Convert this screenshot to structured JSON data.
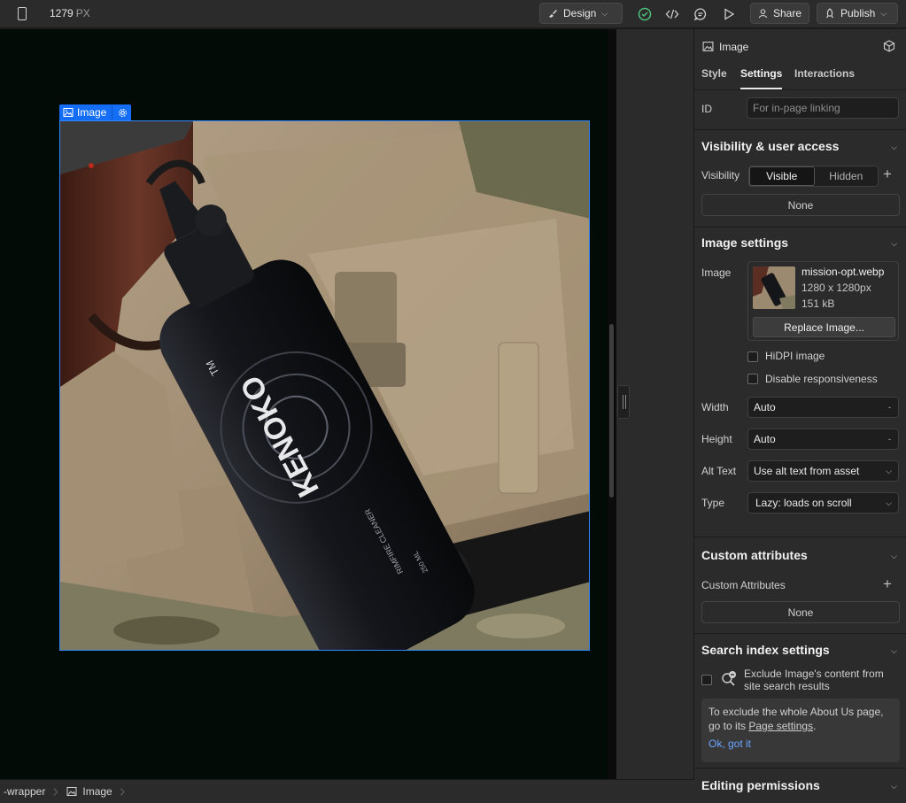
{
  "topbar": {
    "width_value": "1279",
    "width_unit": "PX",
    "design_label": "Design",
    "share_label": "Share",
    "publish_label": "Publish"
  },
  "canvas": {
    "selected_element_label": "Image"
  },
  "breadcrumbs": [
    {
      "label": "-wrapper"
    },
    {
      "label": "Image"
    }
  ],
  "panel": {
    "element_title": "Image",
    "tabs": [
      {
        "label": "Style"
      },
      {
        "label": "Settings"
      },
      {
        "label": "Interactions"
      }
    ],
    "id_label": "ID",
    "id_placeholder": "For in-page linking",
    "visibility_section": {
      "title": "Visibility & user access",
      "visibility_label": "Visibility",
      "visible_option": "Visible",
      "hidden_option": "Hidden",
      "access_value": "None"
    },
    "image_settings": {
      "title": "Image settings",
      "image_label": "Image",
      "file_name": "mission-opt.webp",
      "dimensions": "1280 x 1280px",
      "file_size": "151 kB",
      "replace_label": "Replace Image...",
      "hidpi_label": "HiDPI image",
      "disable_resp_label": "Disable responsiveness",
      "width_label": "Width",
      "width_value": "Auto",
      "width_suffix": "-",
      "height_label": "Height",
      "height_value": "Auto",
      "height_suffix": "-",
      "alt_label": "Alt Text",
      "alt_value": "Use alt text from asset",
      "type_label": "Type",
      "type_value": "Lazy: loads on scroll"
    },
    "custom_attributes": {
      "title": "Custom attributes",
      "sub_label": "Custom Attributes",
      "value": "None"
    },
    "search_index": {
      "title": "Search index settings",
      "exclude_label_line1": "Exclude Image's content from",
      "exclude_label_line2": "site search results",
      "info_line1": "To exclude the whole About Us page,",
      "info_line2_prefix": "go to its ",
      "info_link": "Page settings",
      "info_line2_suffix": ".",
      "ok_label": "Ok, got it"
    },
    "editing_permissions": {
      "title": "Editing permissions"
    }
  },
  "product_image": {
    "brand_text": "KENOKO",
    "tm": "TM",
    "product_text": "RIMFIRE CLEANER",
    "volume_text": "250 ML",
    "colors": {
      "bag": "#9c8a70",
      "stock": "#5a2e22",
      "bottle": "#141518",
      "camo": "#7f7a60"
    }
  }
}
